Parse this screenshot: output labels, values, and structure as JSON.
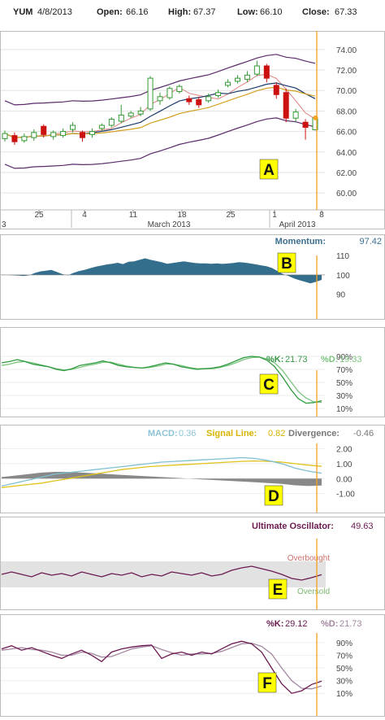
{
  "header": {
    "symbol": "YUM",
    "date": "4/8/2013",
    "open_label": "Open:",
    "open_value": "66.16",
    "high_label": "High:",
    "high_value": "67.37",
    "low_label": "Low:",
    "low_value": "66.10",
    "close_label": "Close:",
    "close_value": "67.33"
  },
  "colors": {
    "up": "#339933",
    "down": "#cc1111",
    "marker_line": "#f0a020",
    "momentum_fill": "#336f8c",
    "k_line": "#2e9a3e",
    "d_line": "#7bc47f",
    "macd": "#7fbfd0",
    "signal": "#e0c21a",
    "divergence": "#888888",
    "uo_line": "#6b1a50",
    "stoch_k": "#6b1a50",
    "stoch_d": "#a286a0",
    "callout_bg": "#ffff00"
  },
  "callouts": [
    "A",
    "B",
    "C",
    "D",
    "E",
    "F"
  ],
  "chart_data": [
    {
      "type": "candlestick",
      "yticks": [
        "74.00",
        "72.00",
        "70.00",
        "68.00",
        "66.00",
        "64.00",
        "62.00",
        "60.00"
      ],
      "ylim": [
        58.5,
        75.5
      ],
      "x_labels": [
        "25",
        "4",
        "11",
        "18",
        "25",
        "1",
        "8"
      ],
      "month_labels": [
        "3",
        "March 2013",
        "April 2013"
      ],
      "candles": [
        {
          "o": 65.3,
          "c": 65.8,
          "h": 66.1,
          "l": 65.0
        },
        {
          "o": 65.6,
          "c": 65.0,
          "h": 65.9,
          "l": 64.7
        },
        {
          "o": 65.1,
          "c": 65.5,
          "h": 65.8,
          "l": 64.9
        },
        {
          "o": 65.4,
          "c": 65.9,
          "h": 66.2,
          "l": 65.1
        },
        {
          "o": 66.5,
          "c": 65.7,
          "h": 66.7,
          "l": 65.4
        },
        {
          "o": 65.5,
          "c": 65.9,
          "h": 66.1,
          "l": 65.2
        },
        {
          "o": 65.6,
          "c": 66.0,
          "h": 66.3,
          "l": 65.4
        },
        {
          "o": 66.2,
          "c": 66.6,
          "h": 66.9,
          "l": 65.9
        },
        {
          "o": 65.9,
          "c": 65.4,
          "h": 66.1,
          "l": 65.0
        },
        {
          "o": 65.7,
          "c": 66.0,
          "h": 66.3,
          "l": 65.4
        },
        {
          "o": 66.3,
          "c": 66.6,
          "h": 66.8,
          "l": 66.0
        },
        {
          "o": 66.6,
          "c": 67.2,
          "h": 67.4,
          "l": 66.4
        },
        {
          "o": 67.0,
          "c": 67.6,
          "h": 68.6,
          "l": 66.8
        },
        {
          "o": 67.5,
          "c": 67.8,
          "h": 68.0,
          "l": 67.3
        },
        {
          "o": 67.7,
          "c": 68.0,
          "h": 68.4,
          "l": 67.5
        },
        {
          "o": 68.2,
          "c": 71.2,
          "h": 71.4,
          "l": 68.0
        },
        {
          "o": 69.0,
          "c": 69.4,
          "h": 69.8,
          "l": 68.6
        },
        {
          "o": 69.3,
          "c": 70.2,
          "h": 70.4,
          "l": 69.1
        },
        {
          "o": 69.9,
          "c": 70.4,
          "h": 70.6,
          "l": 69.7
        },
        {
          "o": 69.2,
          "c": 68.9,
          "h": 69.5,
          "l": 68.6
        },
        {
          "o": 69.1,
          "c": 68.6,
          "h": 69.4,
          "l": 68.3
        },
        {
          "o": 69.0,
          "c": 69.4,
          "h": 69.7,
          "l": 68.8
        },
        {
          "o": 69.5,
          "c": 69.8,
          "h": 70.1,
          "l": 69.3
        },
        {
          "o": 70.5,
          "c": 70.8,
          "h": 71.1,
          "l": 70.3
        },
        {
          "o": 70.9,
          "c": 71.2,
          "h": 71.5,
          "l": 70.7
        },
        {
          "o": 71.1,
          "c": 71.5,
          "h": 71.9,
          "l": 70.8
        },
        {
          "o": 71.6,
          "c": 72.4,
          "h": 72.9,
          "l": 71.4
        },
        {
          "o": 72.4,
          "c": 71.2,
          "h": 72.6,
          "l": 70.8
        },
        {
          "o": 70.5,
          "c": 69.6,
          "h": 70.8,
          "l": 69.2
        },
        {
          "o": 69.8,
          "c": 67.3,
          "h": 70.2,
          "l": 66.9
        },
        {
          "o": 67.3,
          "c": 67.9,
          "h": 68.2,
          "l": 67.0
        },
        {
          "o": 66.9,
          "c": 66.4,
          "h": 67.2,
          "l": 65.2
        },
        {
          "o": 66.16,
          "c": 67.33,
          "h": 67.37,
          "l": 66.1
        }
      ]
    },
    {
      "type": "area",
      "title": "Momentum:",
      "value": "97.42",
      "yticks": [
        "110",
        "100",
        "90"
      ],
      "ylim": [
        78,
        116
      ],
      "values": [
        100,
        100,
        99.8,
        99.6,
        99.4,
        99.8,
        101,
        101.8,
        102.2,
        102.6,
        101.5,
        100.4,
        99.8,
        101,
        102,
        102.6,
        103.4,
        104.2,
        104.8,
        105.4,
        105.8,
        106.3,
        105.6,
        106.8,
        107,
        107.8,
        108.6,
        107.8,
        107.2,
        106.6,
        105.8,
        106.2,
        106.6,
        107,
        106.6,
        106.2,
        106,
        106,
        105.8,
        106,
        105.7,
        105.9,
        106.2,
        106.6,
        106.4,
        106,
        105.5,
        105,
        104.5,
        103.6,
        102,
        100.4,
        99.4,
        98.2,
        97.2,
        96.4,
        95.6,
        96.4,
        97.42
      ]
    },
    {
      "type": "line",
      "title_k": "%K:",
      "value_k": "21.73",
      "title_d": "%D:",
      "value_d": "19.33",
      "yticks": [
        "90%",
        "70%",
        "50%",
        "30%",
        "10%"
      ],
      "ylim": [
        0,
        100
      ],
      "k": [
        80,
        82,
        85,
        82,
        78,
        76,
        74,
        70,
        68,
        71,
        76,
        78,
        80,
        83,
        80,
        76,
        74,
        73,
        72,
        74,
        77,
        80,
        78,
        74,
        72,
        70,
        71,
        72,
        74,
        78,
        83,
        88,
        90,
        89,
        84,
        74,
        58,
        40,
        25,
        18,
        19,
        21.73
      ],
      "d": [
        76,
        78,
        81,
        82,
        80,
        77,
        74,
        71,
        69,
        70,
        73,
        76,
        78,
        81,
        81,
        78,
        75,
        73,
        72,
        73,
        75,
        78,
        78,
        76,
        73,
        71,
        71,
        71,
        73,
        76,
        80,
        85,
        88,
        89,
        86,
        80,
        68,
        52,
        36,
        26,
        20,
        19.33
      ]
    },
    {
      "type": "line",
      "title_macd": "MACD:",
      "value_macd": "0.36",
      "title_signal": "Signal Line:",
      "value_signal": "0.82",
      "title_div": "Divergence:",
      "value_div": "-0.46",
      "yticks": [
        "2.00",
        "1.00",
        "0.00",
        "-1.00"
      ],
      "ylim": [
        -2.0,
        2.3
      ],
      "macd": [
        -0.5,
        -0.3,
        -0.1,
        0.1,
        0.3,
        0.4,
        0.5,
        0.6,
        0.7,
        0.8,
        0.9,
        1.0,
        1.1,
        1.15,
        1.2,
        1.25,
        1.3,
        1.35,
        1.4,
        1.35,
        1.2,
        1.0,
        0.7,
        0.5,
        0.36
      ],
      "signal": [
        -0.6,
        -0.5,
        -0.4,
        -0.3,
        -0.15,
        0.0,
        0.15,
        0.3,
        0.45,
        0.6,
        0.7,
        0.8,
        0.85,
        0.9,
        0.95,
        1.0,
        1.05,
        1.1,
        1.15,
        1.18,
        1.15,
        1.1,
        1.0,
        0.9,
        0.82
      ],
      "divergence": [
        0.1,
        0.2,
        0.3,
        0.4,
        0.45,
        0.45,
        0.4,
        0.35,
        0.3,
        0.25,
        0.2,
        0.15,
        0.1,
        0.05,
        0.0,
        -0.05,
        -0.1,
        -0.15,
        -0.2,
        -0.25,
        -0.3,
        -0.35,
        -0.45,
        -0.5,
        -0.46
      ]
    },
    {
      "type": "line",
      "title": "Ultimate Oscillator:",
      "value": "49.63",
      "overbought_label": "Overbought",
      "oversold_label": "Oversold",
      "values": [
        50,
        53,
        50,
        47,
        52,
        49,
        51,
        48,
        53,
        50,
        47,
        51,
        49,
        52,
        47,
        50,
        48,
        53,
        51,
        49,
        52,
        48,
        50,
        55,
        58,
        60,
        57,
        54,
        50,
        45,
        43,
        46,
        49.63
      ]
    },
    {
      "type": "line",
      "title_k": "%K:",
      "value_k": "29.12",
      "title_d": "%D:",
      "value_d": "21.73",
      "yticks": [
        "90%",
        "70%",
        "50%",
        "30%",
        "10%"
      ],
      "ylim": [
        0,
        100
      ],
      "k": [
        80,
        85,
        78,
        82,
        76,
        70,
        65,
        72,
        78,
        70,
        60,
        75,
        80,
        83,
        85,
        86,
        65,
        72,
        75,
        70,
        75,
        72,
        80,
        88,
        92,
        88,
        75,
        50,
        25,
        10,
        14,
        24,
        29.12
      ],
      "d": [
        78,
        80,
        82,
        79,
        78,
        75,
        70,
        70,
        75,
        73,
        67,
        68,
        74,
        80,
        83,
        85,
        79,
        74,
        70,
        72,
        72,
        73,
        76,
        82,
        88,
        89,
        84,
        72,
        50,
        30,
        18,
        17,
        21.73
      ]
    }
  ]
}
